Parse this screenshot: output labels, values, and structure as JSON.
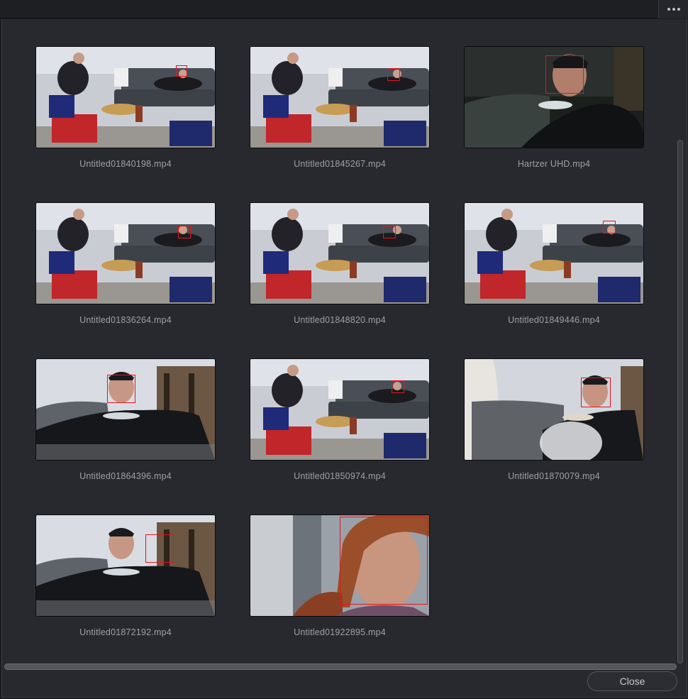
{
  "toolbar": {
    "more_icon": "more-horizontal-icon"
  },
  "colors": {
    "face_box": "#e3151d",
    "background": "#28292e",
    "label": "#9fa0a5"
  },
  "clips": [
    {
      "name": "Untitled01840198.mp4",
      "scene": "wide"
    },
    {
      "name": "Untitled01845267.mp4",
      "scene": "wide"
    },
    {
      "name": "Hartzer UHD.mp4",
      "scene": "closeup-eating"
    },
    {
      "name": "Untitled01836264.mp4",
      "scene": "wide"
    },
    {
      "name": "Untitled01848820.mp4",
      "scene": "wide"
    },
    {
      "name": "Untitled01849446.mp4",
      "scene": "wide"
    },
    {
      "name": "Untitled01864396.mp4",
      "scene": "medium-man"
    },
    {
      "name": "Untitled01850974.mp4",
      "scene": "wide"
    },
    {
      "name": "Untitled01870079.mp4",
      "scene": "medium-man-blur"
    },
    {
      "name": "Untitled01872192.mp4",
      "scene": "medium-man"
    },
    {
      "name": "Untitled01922895.mp4",
      "scene": "closeup-woman"
    }
  ],
  "footer": {
    "close_label": "Close"
  }
}
